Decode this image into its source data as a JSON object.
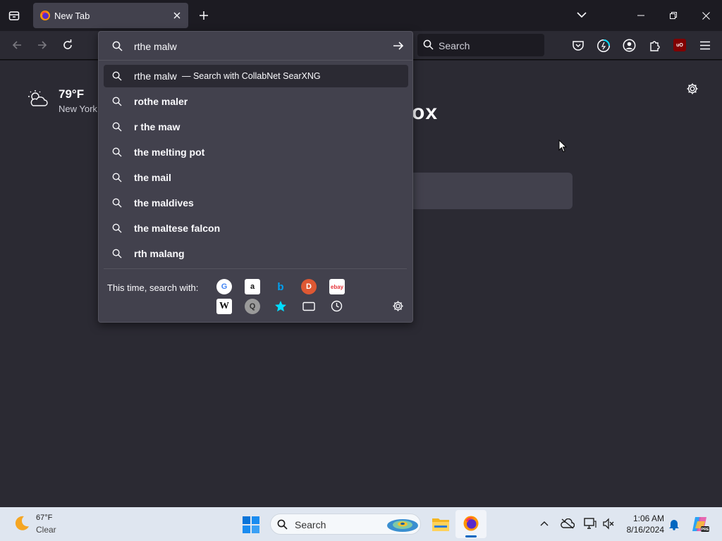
{
  "tab": {
    "title": "New Tab"
  },
  "toolbar": {
    "search_placeholder": "Search"
  },
  "urlbar": {
    "value": "rthe malw",
    "heuristic": {
      "text": "rthe malw",
      "suffix": "— Search with CollabNet SearXNG"
    },
    "suggestions": [
      "rothe maler",
      "r the maw",
      "the melting pot",
      "the mail",
      "the maldives",
      "the maltese falcon",
      "rth malang"
    ],
    "oneoff_label": "This time, search with:",
    "engines": [
      "google-icon",
      "amazon-icon",
      "bing-icon",
      "duckduckgo-icon",
      "ebay-icon",
      "wikipedia-icon",
      "searxng-icon",
      "bookmarks-icon",
      "tabs-icon",
      "history-icon"
    ]
  },
  "weather": {
    "temp": "79°F",
    "location": "New York"
  },
  "brand": {
    "visible_text": "ox"
  },
  "taskbar": {
    "weather_temp": "67°F",
    "weather_cond": "Clear",
    "search_label": "Search",
    "time": "1:06 AM",
    "date": "8/16/2024"
  },
  "colors": {
    "accent": "#00ddff",
    "toolbar_bg": "#2b2a33",
    "panel_bg": "#42414d",
    "taskbar_bg": "#dfe6f0"
  }
}
